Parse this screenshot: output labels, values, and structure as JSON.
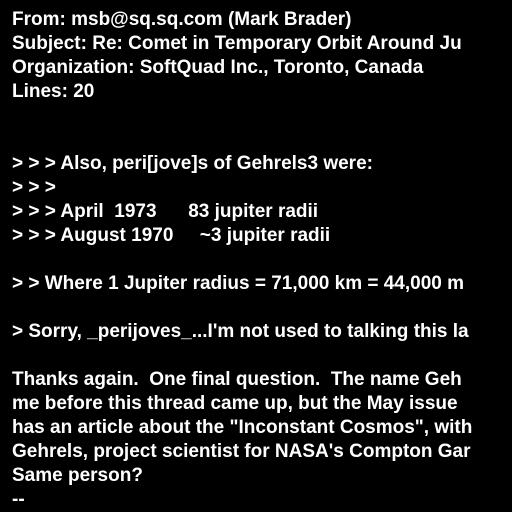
{
  "header": {
    "from": "From: msb@sq.sq.com (Mark Brader)",
    "subject": "Subject: Re: Comet in Temporary Orbit Around Ju",
    "organization": "Organization: SoftQuad Inc., Toronto, Canada",
    "lines": "Lines: 20"
  },
  "quote3": [
    "> > > Also, peri[jove]s of Gehrels3 were:",
    "> > >",
    "> > > April  1973      83 jupiter radii",
    "> > > August 1970     ~3 jupiter radii"
  ],
  "quote2": "> > Where 1 Jupiter radius = 71,000 km = 44,000 m",
  "quote1": "> Sorry, _perijoves_...I'm not used to talking this la",
  "body": [
    "Thanks again.  One final question.  The name Geh",
    "me before this thread came up, but the May issue",
    "has an article about the \"Inconstant Cosmos\", with",
    "Gehrels, project scientist for NASA's Compton Gar",
    "Same person?",
    "--"
  ]
}
